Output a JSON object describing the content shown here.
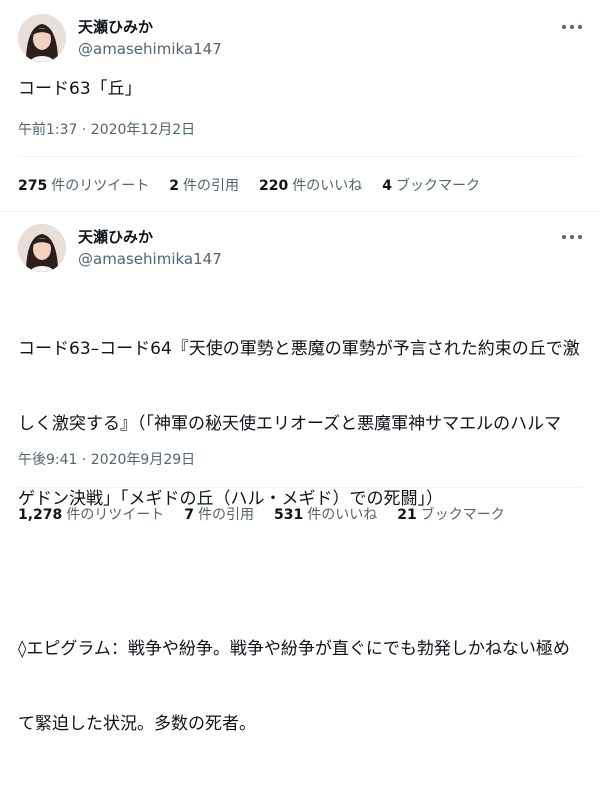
{
  "tweets": [
    {
      "name": "天瀬ひみか",
      "handle": "@amasehimika147",
      "text": "コード63「丘」",
      "timestamp": "午前1:37 · 2020年12月2日",
      "stats": [
        {
          "count": "275",
          "label": "件のリツイート"
        },
        {
          "count": "2",
          "label": "件の引用"
        },
        {
          "count": "220",
          "label": "件のいいね"
        },
        {
          "count": "4",
          "label": "ブックマーク"
        }
      ]
    },
    {
      "name": "天瀬ひみか",
      "handle": "@amasehimika147",
      "text_lines": [
        "コード63–コード64『天使の軍勢と悪魔の軍勢が予言された約束の丘で激",
        "しく激突する』（「神軍の秘天使エリオーズと悪魔軍神サマエルのハルマ",
        "ゲドン決戦」「メギドの丘（ハル・メギド）での死闘」）",
        "",
        "◊エピグラム：戦争や紛争。戦争や紛争が直ぐにでも勃発しかねない極め",
        "て緊迫した状況。多数の死者。"
      ],
      "timestamp": "午後9:41 · 2020年9月29日",
      "stats": [
        {
          "count": "1,278",
          "label": "件のリツイート"
        },
        {
          "count": "7",
          "label": "件の引用"
        },
        {
          "count": "531",
          "label": "件のいいね"
        },
        {
          "count": "21",
          "label": "ブックマーク"
        }
      ]
    }
  ],
  "icons": {
    "more": "more-icon",
    "avatar": "avatar"
  },
  "colors": {
    "text": "#0f1419",
    "secondary": "#536471",
    "divider": "#eff3f4"
  }
}
